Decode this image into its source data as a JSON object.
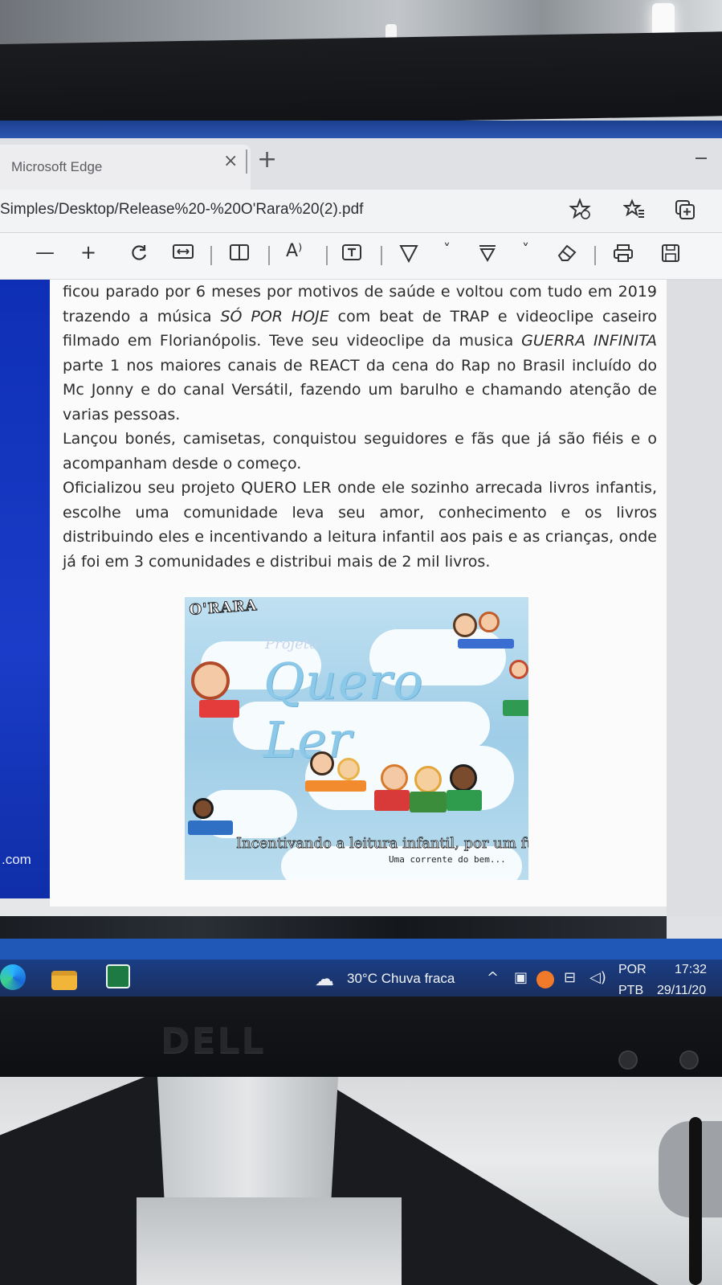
{
  "browser": {
    "tab_title": "Microsoft Edge",
    "tab_close": "×",
    "new_tab": "+",
    "url": "Simples/Desktop/Release%20-%20O'Rara%20(2).pdf"
  },
  "pdf_toolbar": {
    "zoom_out": "—",
    "zoom_in": "+",
    "read_aloud": "A⁾",
    "text_tool": "T",
    "draw": "∇",
    "chevron": "˅"
  },
  "side_panel": {
    "text": ".com"
  },
  "document": {
    "paragraph1_a": "ficou parado por 6 meses por motivos de saúde e voltou com tudo em 2019 trazendo a música ",
    "paragraph1_song1": "SÓ POR HOJE",
    "paragraph1_b": " com beat de TRAP e videoclipe caseiro filmado em Florianópolis. Teve seu videoclipe da musica ",
    "paragraph1_song2": "GUERRA INFINITA",
    "paragraph1_c": " parte 1 nos maiores canais de REACT da cena do Rap no Brasil incluído do Mc Jonny e do canal Versátil, fazendo um barulho e chamando atenção de varias pessoas.",
    "paragraph2": "Lançou bonés, camisetas, conquistou seguidores e fãs que já são fiéis e o acompanham desde o começo.",
    "paragraph3": "Oficializou seu projeto QUERO LER onde ele sozinho arrecada livros infantis, escolhe uma comunidade leva seu amor, conhecimento e os livros distribuindo eles e incentivando a leitura infantil aos pais e as crianças, onde já foi em 3 comunidades e distribui mais de 2 mil livros."
  },
  "poster": {
    "logo": "O'RARA",
    "subtitle": "Projeto",
    "title": "Quero Ler",
    "slogan": "Incentivando a leitura infantil, por um futuro melhor.",
    "tagline": "Uma corrente do bem..."
  },
  "taskbar": {
    "weather": "30°C  Chuva fraca",
    "language_top": "POR",
    "language_bottom": "PTB",
    "time": "17:32",
    "date": "29/11/20"
  },
  "monitor": {
    "brand": "DELL"
  }
}
